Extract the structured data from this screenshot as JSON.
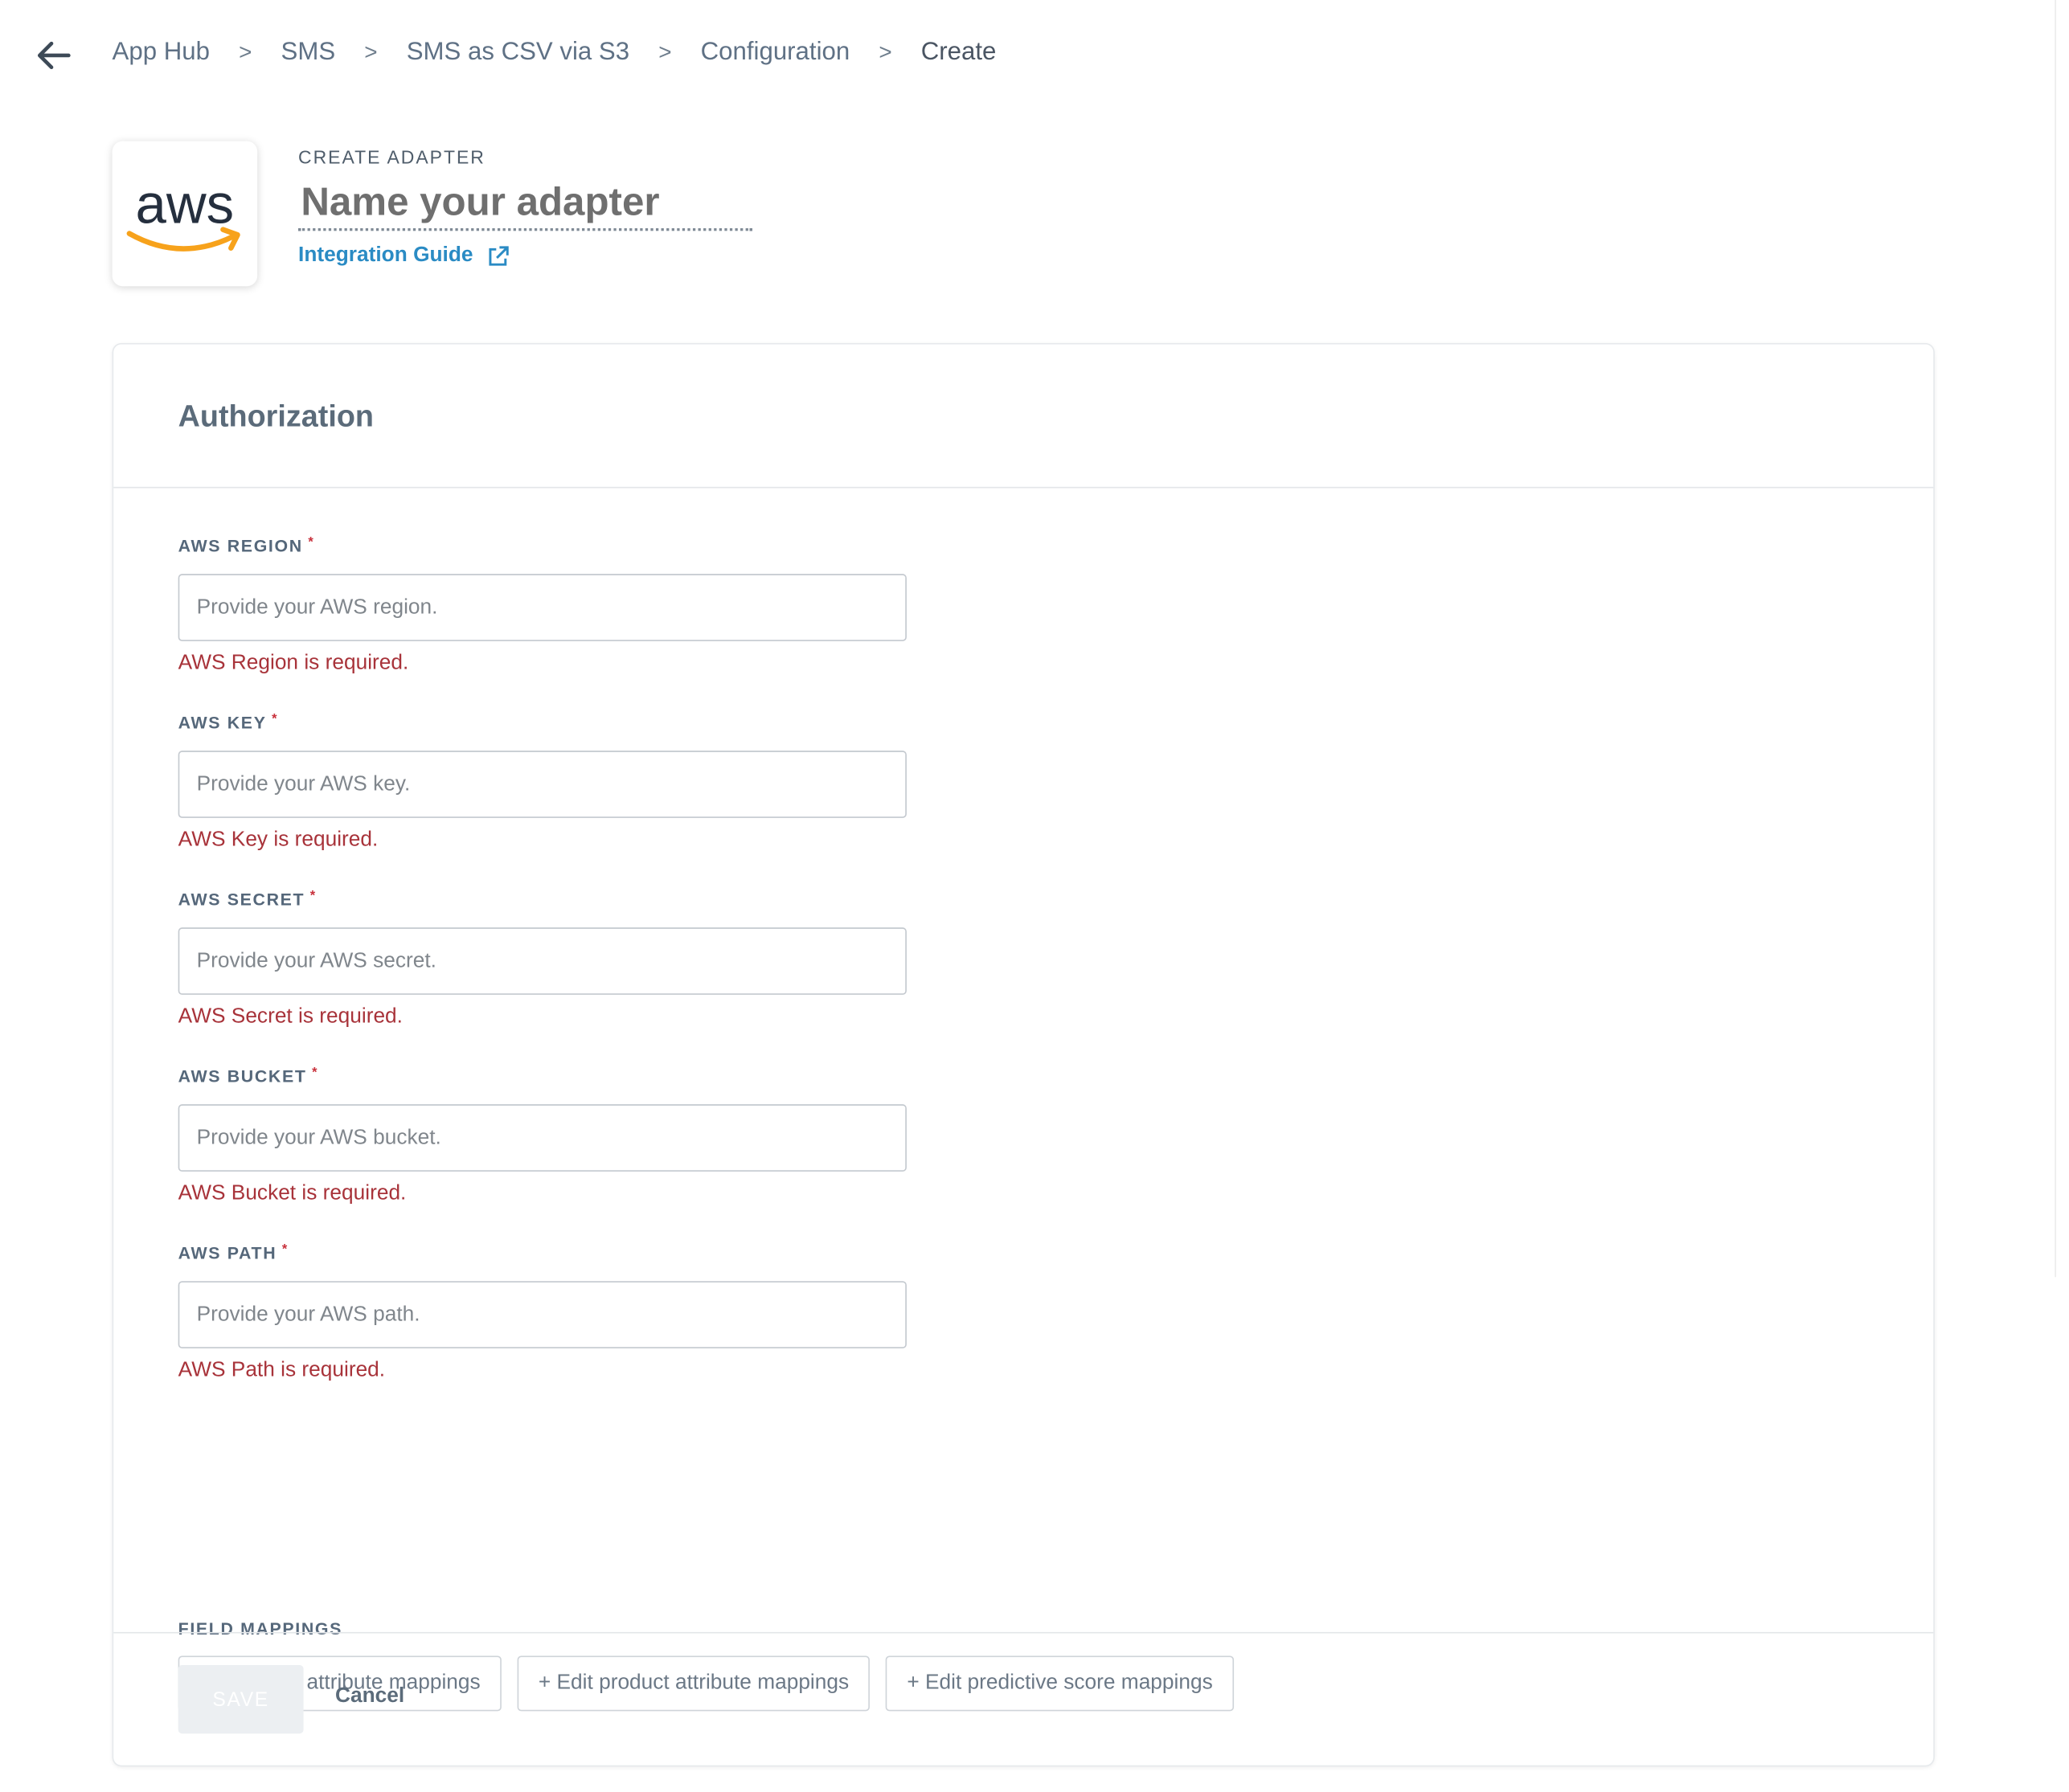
{
  "breadcrumb": {
    "items": [
      "App Hub",
      "SMS",
      "SMS as CSV via S3",
      "Configuration",
      "Create"
    ],
    "separator": ">"
  },
  "header": {
    "eyebrow": "CREATE ADAPTER",
    "name_placeholder": "Name your adapter",
    "name_value": "",
    "integration_guide_label": "Integration Guide",
    "logo": "aws-logo"
  },
  "authorization": {
    "title": "Authorization",
    "fields": [
      {
        "label": "AWS REGION",
        "required_marker": "*",
        "placeholder": "Provide your AWS region.",
        "value": "",
        "error": "AWS Region is required."
      },
      {
        "label": "AWS KEY",
        "required_marker": "*",
        "placeholder": "Provide your AWS key.",
        "value": "",
        "error": "AWS Key is required."
      },
      {
        "label": "AWS SECRET",
        "required_marker": "*",
        "placeholder": "Provide your AWS secret.",
        "value": "",
        "error": "AWS Secret is required."
      },
      {
        "label": "AWS BUCKET",
        "required_marker": "*",
        "placeholder": "Provide your AWS bucket.",
        "value": "",
        "error": "AWS Bucket is required."
      },
      {
        "label": "AWS PATH",
        "required_marker": "*",
        "placeholder": "Provide your AWS path.",
        "value": "",
        "error": "AWS Path is required."
      }
    ]
  },
  "field_mappings": {
    "label": "FIELD MAPPINGS",
    "buttons": [
      "+ Edit user attribute mappings",
      "+ Edit product attribute mappings",
      "+ Edit predictive score mappings"
    ]
  },
  "footer": {
    "save_label": "SAVE",
    "cancel_label": "Cancel"
  },
  "colors": {
    "link": "#2a8bc4",
    "error": "#a8333a",
    "required": "#c8303b",
    "aws_orange": "#f7a21b",
    "aws_text": "#252f3e"
  }
}
